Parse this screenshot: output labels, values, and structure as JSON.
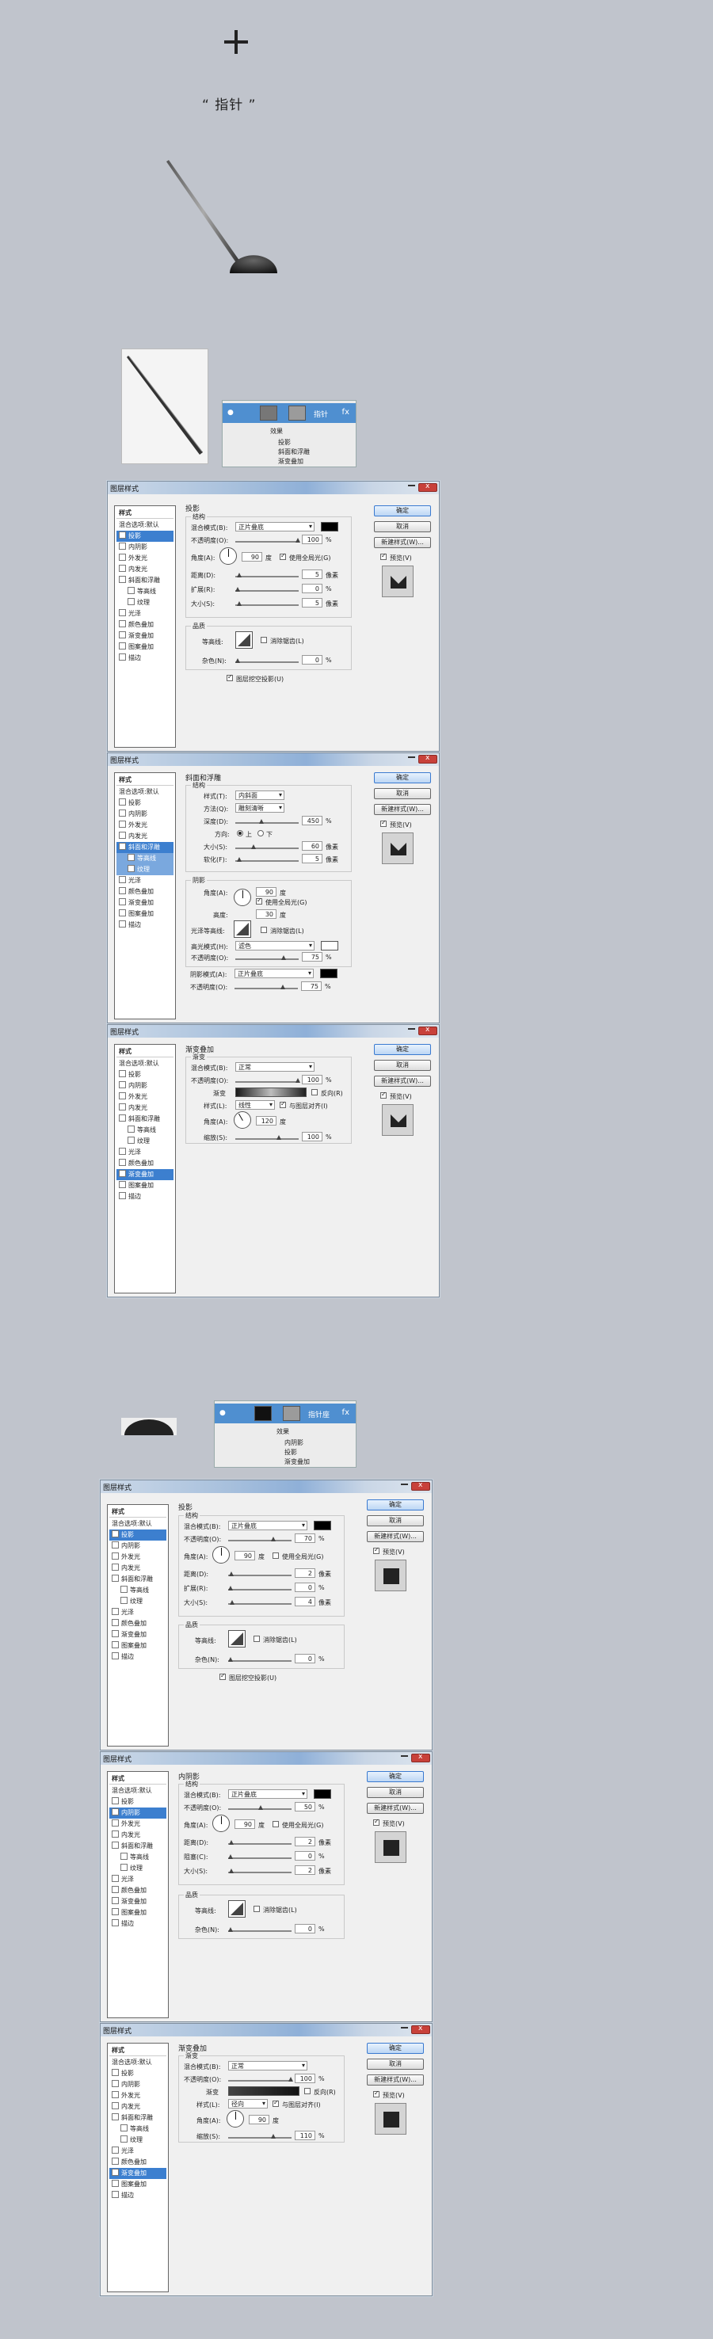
{
  "header": {
    "caption": "“ 指针 ”"
  },
  "panel1": {
    "layer_name": "指针",
    "effects_label": "效果",
    "effects": [
      "投影",
      "斜面和浮雕",
      "渐变叠加"
    ],
    "fx": "fx"
  },
  "panel2": {
    "layer_name": "指针座",
    "effects_label": "效果",
    "effects": [
      "内阴影",
      "投影",
      "渐变叠加"
    ],
    "fx": "fx"
  },
  "dialog": {
    "title": "图层样式",
    "ok": "确定",
    "cancel": "取消",
    "new_style": "新建样式(W)...",
    "preview": "预览(V)",
    "sidebar": [
      "样式",
      "混合选项:默认",
      "投影",
      "内阴影",
      "外发光",
      "内发光",
      "斜面和浮雕",
      "等高线",
      "纹理",
      "光泽",
      "颜色叠加",
      "渐变叠加",
      "图案叠加",
      "描边"
    ]
  },
  "labels": {
    "structure": "结构",
    "quality": "品质",
    "shading": "阴影",
    "gradient": "渐变",
    "blend_mode": "混合模式(B):",
    "opacity": "不透明度(O):",
    "angle": "角度(A):",
    "degree": "度",
    "global_light": "使用全局光(G)",
    "distance": "距离(D):",
    "spread": "扩展(R):",
    "choke": "阻塞(C):",
    "size": "大小(S):",
    "px": "像素",
    "pct": "%",
    "contour": "等高线:",
    "antialias": "消除锯齿(L)",
    "noise": "杂色(N):",
    "knockout": "图层挖空投影(U)",
    "style": "样式(T):",
    "technique": "方法(Q):",
    "depth": "深度(D):",
    "direction": "方向:",
    "up": "上",
    "down": "下",
    "soften": "软化(F):",
    "altitude": "高度:",
    "gloss": "光泽等高线:",
    "highlight": "高光模式(H):",
    "shadow_mode": "阴影模式(A):",
    "reverse": "反向(R)",
    "align": "与图层对齐(I)",
    "scale": "缩放(S):",
    "grad_style": "样式(L):"
  },
  "d1": {
    "section": "投影",
    "mode": "正片叠底",
    "opacity": "100",
    "angle": "90",
    "distance": "5",
    "spread": "0",
    "size": "5",
    "noise": "0"
  },
  "d2": {
    "section": "斜面和浮雕",
    "style": "内斜面",
    "technique": "雕刻清晰",
    "depth": "450",
    "size": "60",
    "soften": "5",
    "angle": "90",
    "altitude": "30",
    "hl_mode": "滤色",
    "hl_opacity": "75",
    "sh_mode": "正片叠底",
    "sh_opacity": "75"
  },
  "d3": {
    "section": "渐变叠加",
    "mode": "正常",
    "opacity": "100",
    "style": "线性",
    "angle": "120",
    "scale": "100"
  },
  "d4": {
    "section": "投影",
    "mode": "正片叠底",
    "opacity": "70",
    "angle": "90",
    "distance": "2",
    "spread": "0",
    "size": "4",
    "noise": "0"
  },
  "d5": {
    "section": "内阴影",
    "mode": "正片叠底",
    "opacity": "50",
    "angle": "90",
    "distance": "2",
    "choke": "0",
    "size": "2",
    "noise": "0"
  },
  "d6": {
    "section": "渐变叠加",
    "mode": "正常",
    "opacity": "100",
    "style": "径向",
    "angle": "90",
    "scale": "110"
  },
  "colors": {
    "bg": "#c0c4cc",
    "selection": "#3c7fcf",
    "layer_row": "#4f8fd0"
  }
}
